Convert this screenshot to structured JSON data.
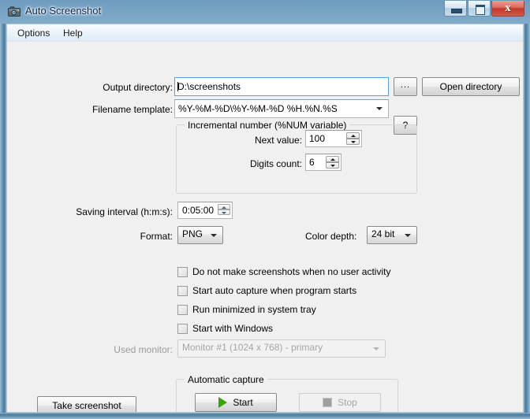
{
  "window": {
    "title": "Auto Screenshot",
    "icon": "camera-icon",
    "caption_buttons": {
      "minimize": "minimize-icon",
      "maximize": "maximize-icon",
      "close": "x"
    }
  },
  "menu": {
    "items": [
      {
        "label": "Options"
      },
      {
        "label": "Help"
      }
    ]
  },
  "form": {
    "output_directory": {
      "label": "Output directory:",
      "value": "D:\\screenshots",
      "browse_label": "...",
      "open_label": "Open directory"
    },
    "filename_template": {
      "label": "Filename template:",
      "value": "%Y-%M-%D\\%Y-%M-%D %H.%N.%S",
      "help_label": "?"
    },
    "incremental_number": {
      "group_title": "Incremental number (%NUM variable)",
      "next_value": {
        "label": "Next value:",
        "value": "100"
      },
      "digits_count": {
        "label": "Digits count:",
        "value": "6"
      }
    },
    "saving_interval": {
      "label": "Saving interval (h:m:s):",
      "value": "0:05:00"
    },
    "format": {
      "label": "Format:",
      "value": "PNG"
    },
    "color_depth": {
      "label": "Color depth:",
      "value": "24 bit"
    },
    "checkboxes": [
      {
        "label": "Do not make screenshots when no user activity",
        "checked": false
      },
      {
        "label": "Start auto capture when program starts",
        "checked": false
      },
      {
        "label": "Run minimized in system tray",
        "checked": false
      },
      {
        "label": "Start with Windows",
        "checked": false
      }
    ],
    "used_monitor": {
      "label": "Used monitor:",
      "value": "Monitor #1 (1024 x 768) - primary",
      "enabled": false
    },
    "take_screenshot_label": "Take screenshot",
    "automatic_capture": {
      "group_title": "Automatic capture",
      "start_label": "Start",
      "stop_label": "Stop",
      "start_enabled": true,
      "stop_enabled": false
    }
  },
  "colors": {
    "frame": "#4e7f9f",
    "client_bg": "#f0f0f0",
    "close_button": "#c0392b",
    "play_green": "#3aa30a",
    "disabled_text": "#9a9a9a"
  }
}
